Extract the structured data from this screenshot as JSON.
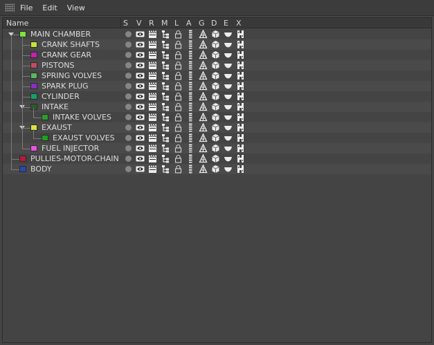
{
  "menu": {
    "items": [
      {
        "label": "File"
      },
      {
        "label": "Edit"
      },
      {
        "label": "View"
      }
    ]
  },
  "columns": {
    "name": "Name",
    "flags": [
      "S",
      "V",
      "R",
      "M",
      "L",
      "A",
      "G",
      "D",
      "E",
      "X"
    ]
  },
  "objects": [
    {
      "label": "MAIN CHAMBER",
      "color": "#7be63a",
      "depth": 0,
      "expandable": true,
      "expanded": true
    },
    {
      "label": "CRANK SHAFTS",
      "color": "#c6e23a",
      "depth": 1
    },
    {
      "label": "CRANK GEAR",
      "color": "#c81fb0",
      "depth": 1
    },
    {
      "label": "PISTONS",
      "color": "#c24a66",
      "depth": 1
    },
    {
      "label": "SPRING VOLVES",
      "color": "#5ab85a",
      "depth": 1
    },
    {
      "label": "SPARK PLUG",
      "color": "#8a2cc6",
      "depth": 1
    },
    {
      "label": "CYLINDER",
      "color": "#15a06a",
      "depth": 1
    },
    {
      "label": "INTAKE",
      "color": "#2e5a2e",
      "depth": 1,
      "expandable": true,
      "expanded": true
    },
    {
      "label": "INTAKE VOLVES",
      "color": "#2c9c2c",
      "depth": 2
    },
    {
      "label": "EXAUST",
      "color": "#d8e240",
      "depth": 1,
      "expandable": true,
      "expanded": true
    },
    {
      "label": "EXAUST VOLVES",
      "color": "#1fa01f",
      "depth": 2
    },
    {
      "label": "FUEL INJECTOR",
      "color": "#e454e0",
      "depth": 1
    },
    {
      "label": "PULLIES-MOTOR-CHAIN",
      "color": "#b81a3a",
      "depth": 0
    },
    {
      "label": "BODY",
      "color": "#2a48b0",
      "depth": 0
    }
  ],
  "row_icons": [
    "solo-dot-icon",
    "eye-icon",
    "clapperboard-icon",
    "hierarchy-icon",
    "lock-icon",
    "animation-track-icon",
    "generator-icon",
    "deformer-icon",
    "expression-icon",
    "xref-icon"
  ]
}
